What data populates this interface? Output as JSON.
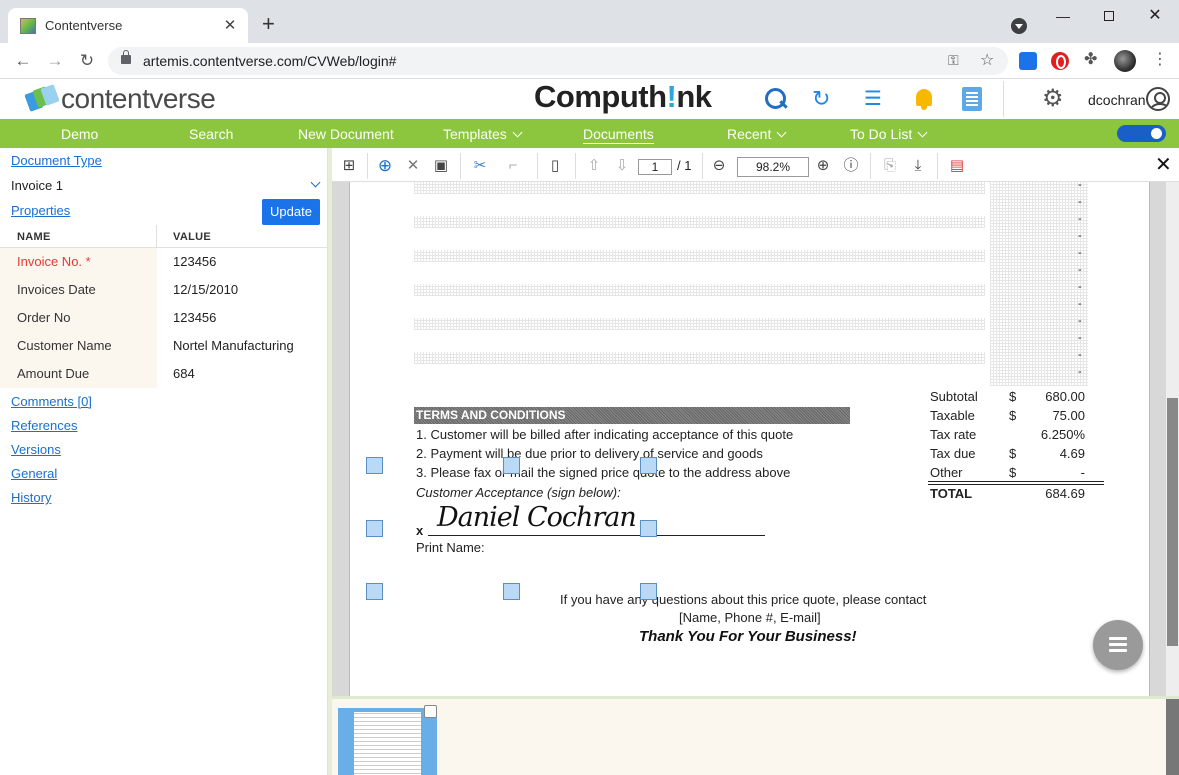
{
  "browser": {
    "tab_title": "Contentverse",
    "url": "artemis.contentverse.com/CVWeb/login#"
  },
  "header": {
    "logo_text": "contentverse",
    "brand_prefix": "Computh",
    "brand_accent": "!",
    "brand_suffix": "nk",
    "username": "dcochran"
  },
  "menu": {
    "items": [
      {
        "label": "Demo"
      },
      {
        "label": "Search"
      },
      {
        "label": "New Document"
      },
      {
        "label": "Templates"
      },
      {
        "label": "Documents"
      },
      {
        "label": "Recent"
      },
      {
        "label": "To Do List"
      }
    ],
    "active": "Documents"
  },
  "left": {
    "document_type_label": "Document Type",
    "document_type_value": "Invoice 1",
    "properties_label": "Properties",
    "update_label": "Update",
    "table_headers": {
      "name": "NAME",
      "value": "VALUE"
    },
    "rows": [
      {
        "name": "Invoice No. *",
        "value": "123456",
        "required": true
      },
      {
        "name": "Invoices Date",
        "value": "12/15/2010"
      },
      {
        "name": "Order No",
        "value": "123456"
      },
      {
        "name": "Customer Name",
        "value": "Nortel Manufacturing"
      },
      {
        "name": "Amount Due",
        "value": "684"
      }
    ],
    "links": [
      "Comments [0]",
      "References",
      "Versions",
      "General",
      "History"
    ]
  },
  "viewer": {
    "page_current": "1",
    "page_total": "/ 1",
    "zoom": "98.2%"
  },
  "document": {
    "terms_title": "TERMS AND CONDITIONS",
    "terms": [
      "1. Customer will be billed after indicating acceptance of this quote",
      "2. Payment will be due prior to delivery of service and goods",
      "3. Please fax or mail the signed price quote to the address above"
    ],
    "acceptance": "Customer Acceptance (sign below):",
    "x_mark": "x",
    "signature": "Daniel Cochran",
    "print_name": "Print Name:",
    "contact_line1": "If you have any questions about this price quote, please contact",
    "contact_line2": "[Name, Phone #, E-mail]",
    "thanks": "Thank You For Your Business!",
    "totals": [
      {
        "label": "Subtotal",
        "currency": "$",
        "value": "680.00"
      },
      {
        "label": "Taxable",
        "currency": "$",
        "value": "75.00"
      },
      {
        "label": "Tax rate",
        "currency": "",
        "value": "6.250%"
      },
      {
        "label": "Tax due",
        "currency": "$",
        "value": "4.69"
      },
      {
        "label": "Other",
        "currency": "$",
        "value": "-"
      }
    ],
    "total": {
      "label": "TOTAL",
      "value": "684.69"
    },
    "dash": "-"
  },
  "colors": {
    "menu_green": "#8cc63e",
    "link_blue": "#1a6fd0",
    "button_blue": "#1a73e8",
    "required_red": "#e53935"
  }
}
